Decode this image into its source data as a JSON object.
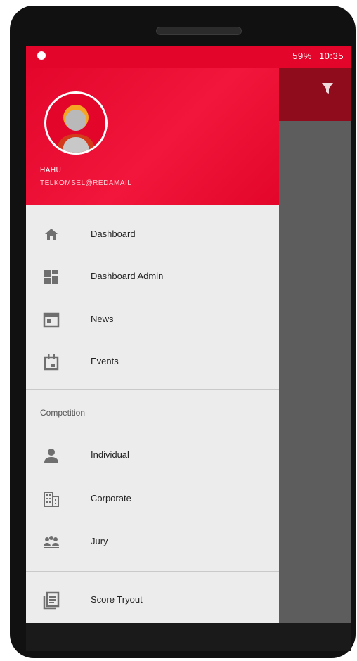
{
  "status_bar": {
    "battery": "59%",
    "time": "10:35"
  },
  "drawer_header": {
    "name": "HAHU",
    "email": "TELKOMSEL@REDAMAIL"
  },
  "menu": {
    "dashboard": "Dashboard",
    "dashboard_admin": "Dashboard Admin",
    "news": "News",
    "events": "Events",
    "competition_header": "Competition",
    "individual": "Individual",
    "corporate": "Corporate",
    "jury": "Jury",
    "score_tryout": "Score Tryout"
  },
  "icons": [
    "home-icon",
    "dashboard-icon",
    "news-icon",
    "events-icon",
    "person-icon",
    "corporate-icon",
    "jury-icon",
    "score-icon",
    "filter-icon"
  ],
  "colors": {
    "primary": "#e3062a",
    "appbar_dark": "#8e0c1c",
    "drawer_bg": "#ececec"
  }
}
